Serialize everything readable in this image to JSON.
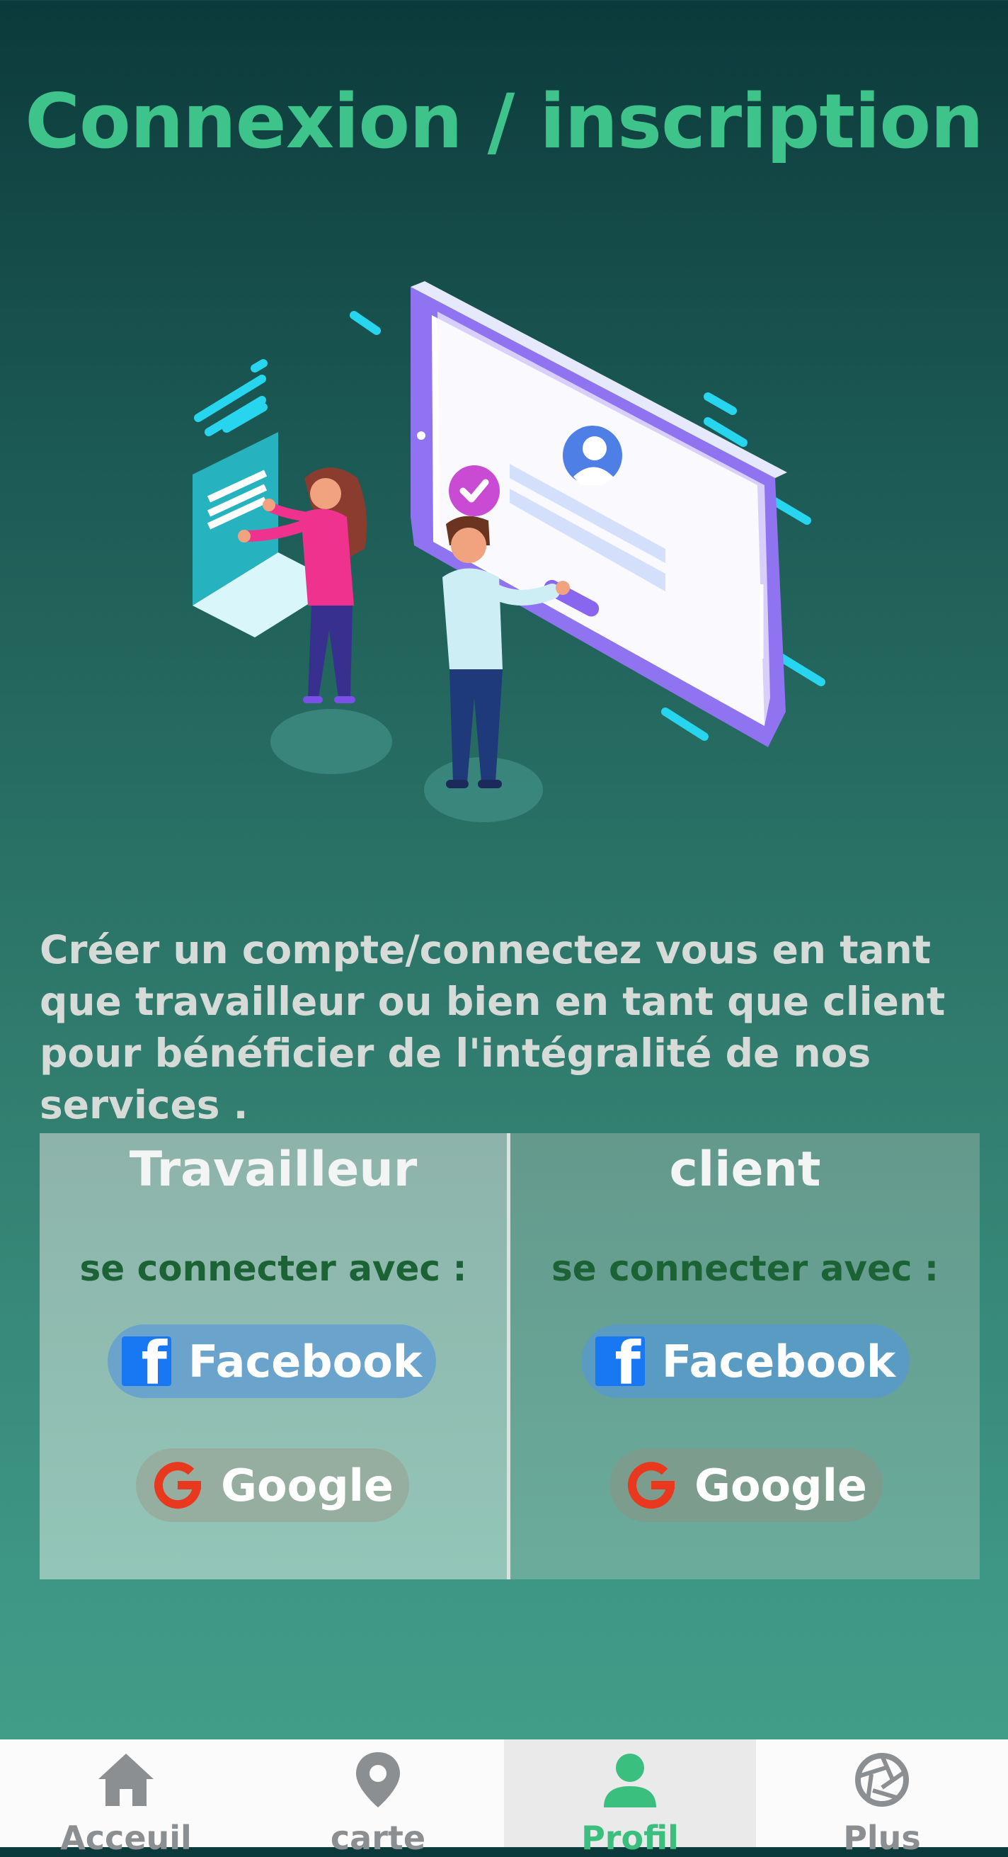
{
  "header": {
    "title": "Connexion / inscription"
  },
  "intro": {
    "text": "Créer un compte/connectez vous en tant que travailleur ou bien en tant que client pour bénéficier de l'intégralité de nos services ."
  },
  "panels": [
    {
      "title": "Travailleur",
      "connect_label": "se connecter avec :",
      "facebook_label": "Facebook",
      "google_label": "Google"
    },
    {
      "title": "client",
      "connect_label": "se connecter avec :",
      "facebook_label": "Facebook",
      "google_label": "Google"
    }
  ],
  "nav": {
    "items": [
      {
        "label": "Acceuil",
        "icon": "home-icon",
        "active": false
      },
      {
        "label": "carte",
        "icon": "map-pin-icon",
        "active": false
      },
      {
        "label": "Profil",
        "icon": "user-icon",
        "active": true
      },
      {
        "label": "Plus",
        "icon": "aperture-icon",
        "active": false
      }
    ]
  },
  "colors": {
    "title": "#3ec38a",
    "nav_active": "#3bbf7f",
    "nav_inactive": "#8c8f92",
    "facebook": "#1877f2",
    "google_g": "#e8381e",
    "connect_label": "#1b6335"
  }
}
